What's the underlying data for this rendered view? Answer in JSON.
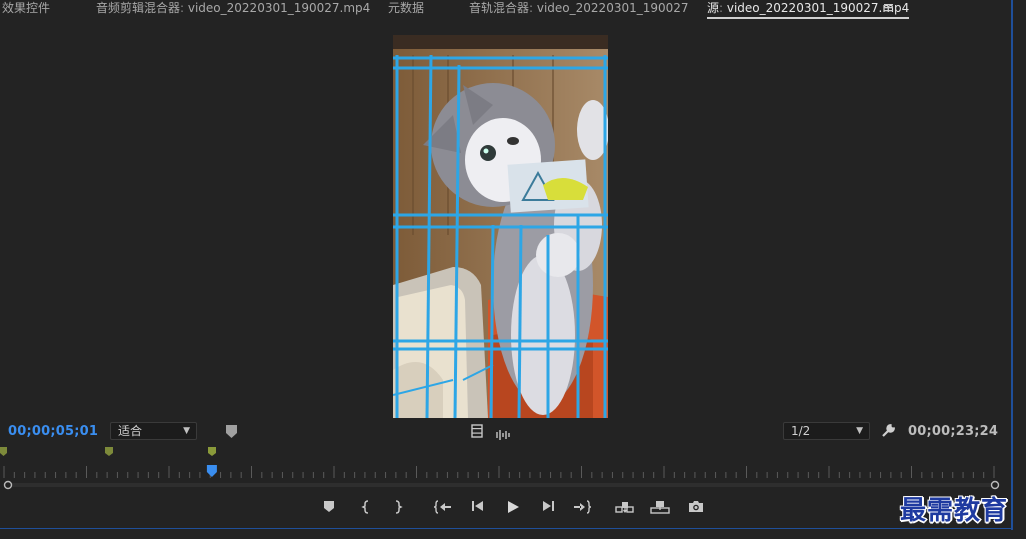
{
  "tabs": [
    {
      "name": "效果控件",
      "file": ""
    },
    {
      "name": "音频剪辑混合器",
      "file": "video_20220301_190027.mp4"
    },
    {
      "name": "元数据",
      "file": ""
    },
    {
      "name": "音轨混合器",
      "file": "video_20220301_190027"
    },
    {
      "name": "源",
      "file": "video_20220301_190027.mp4"
    }
  ],
  "source": {
    "current_timecode": "00;00;05;01",
    "duration_timecode": "00;00;23;24",
    "zoom_select": "适合",
    "resolution_select": "1/2",
    "playhead_fraction": 0.21
  },
  "watermark": "最需教育",
  "colors": {
    "accent_blue": "#3a8ef0",
    "panel_bg": "#232323",
    "marker_green": "#8a9a3a"
  }
}
